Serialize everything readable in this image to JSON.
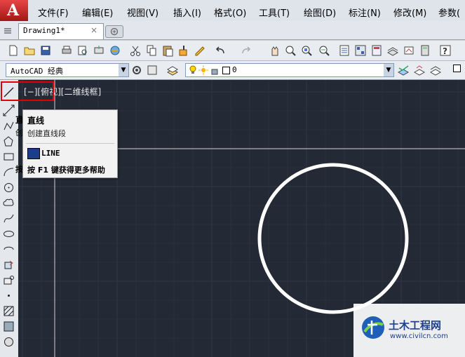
{
  "app": {
    "logo_letter": "A"
  },
  "menu": {
    "items": [
      "文件(F)",
      "编辑(E)",
      "视图(V)",
      "插入(I)",
      "格式(O)",
      "工具(T)",
      "绘图(D)",
      "标注(N)",
      "修改(M)",
      "参数("
    ]
  },
  "tabs": {
    "drawing": "Drawing1*",
    "close": "×"
  },
  "workspace": {
    "selected": "AutoCAD 经典"
  },
  "layer": {
    "selected": "0"
  },
  "viewport": {
    "label": "[−][俯视][二维线框]"
  },
  "tooltip": {
    "title": "直线",
    "description": "创建直线段",
    "command": "LINE",
    "help": "按 F1 键获得更多帮助",
    "behind_left": [
      "直",
      "创",
      "按"
    ]
  },
  "watermark": {
    "title": "土木工程网",
    "url": "www.civilcn.com"
  },
  "colors": {
    "canvas": "#232a35",
    "grid": "#2e3644",
    "highlight": "#e00000"
  }
}
